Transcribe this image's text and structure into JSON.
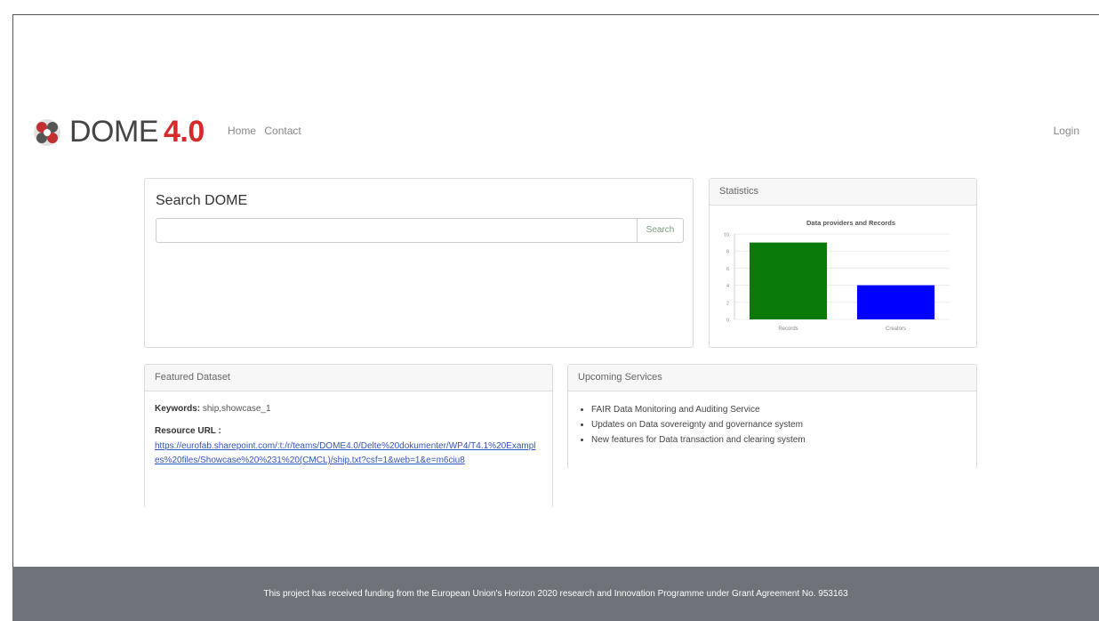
{
  "brand": {
    "name": "DOME",
    "version": "4.0"
  },
  "nav": {
    "home": "Home",
    "contact": "Contact",
    "login": "Login"
  },
  "search": {
    "title": "Search DOME",
    "button": "Search",
    "value": "",
    "placeholder": ""
  },
  "stats": {
    "header": "Statistics"
  },
  "chart_data": {
    "type": "bar",
    "title": "Data providers and Records",
    "categories": [
      "Records",
      "Creators"
    ],
    "values": [
      9,
      4
    ],
    "colors": [
      "#0a7a0a",
      "#0000ff"
    ],
    "ylim": [
      0,
      10
    ],
    "yticks": [
      "10",
      "8",
      "6",
      "4",
      "2",
      "0"
    ],
    "grid": true
  },
  "featured": {
    "header": "Featured Dataset",
    "keywords_label": "Keywords:",
    "keywords_value": "ship,showcase_1",
    "resource_label": "Resource URL :",
    "resource_url": "https://eurofab.sharepoint.com/:t:/r/teams/DOME4.0/Delte%20dokumenter/WP4/T4.1%20Examples%20files/Showcase%20%231%20(CMCL)/ship.txt?csf=1&web=1&e=m6ciu8"
  },
  "services": {
    "header": "Upcoming Services",
    "items": [
      "FAIR Data Monitoring and Auditing Service",
      "Updates on Data sovereignty and governance system",
      "New features for Data transaction and clearing system"
    ]
  },
  "footer": {
    "text": "This project has received funding from the European Union's Horizon 2020 research and Innovation Programme under Grant Agreement No. 953163"
  }
}
